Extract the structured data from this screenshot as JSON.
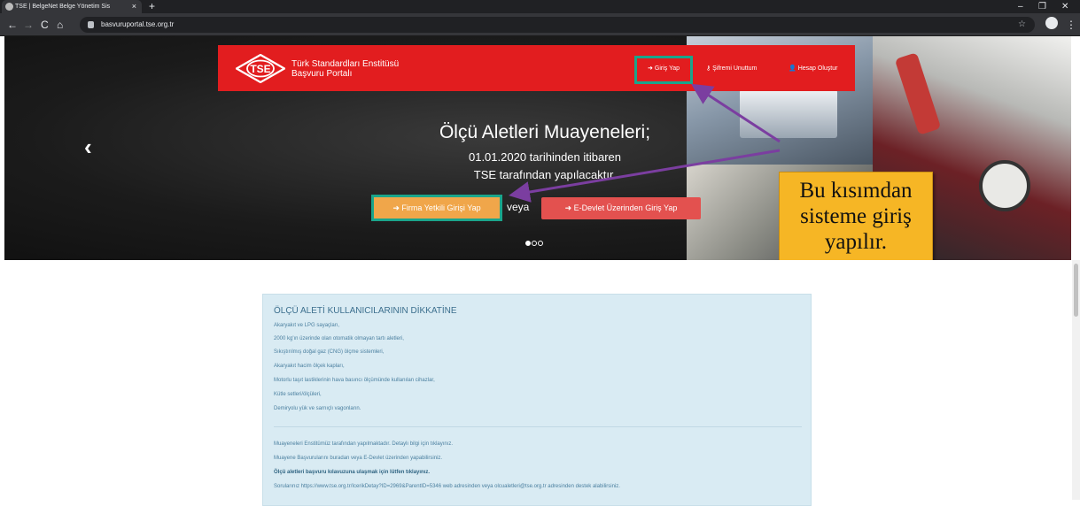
{
  "browser": {
    "tab_title": "TSE | BelgeNet Belge Yönetim Sis",
    "tab_close": "×",
    "new_tab": "+",
    "url": "basvuruportal.tse.org.tr",
    "nav_back": "←",
    "nav_forward": "→",
    "nav_reload": "C",
    "nav_home": "⌂",
    "star": "☆",
    "menu": "⋮",
    "win_min": "–",
    "win_max": "❐",
    "win_close": "✕"
  },
  "header": {
    "org_line1": "Türk Standardları Enstitüsü",
    "org_line2": "Başvuru Portalı",
    "logo_text": "TSE",
    "nav_login": "Giriş Yap",
    "nav_forgot": "Şifremi Unuttum",
    "nav_register": "Hesap Oluştur",
    "brand_color": "#e21d1f"
  },
  "hero": {
    "prev_arrow": "‹",
    "heading": "Ölçü Aletleri Muayeneleri;",
    "line1": "01.01.2020 tarihinden itibaren",
    "line2": "TSE tarafından yapılacaktır.",
    "btn_firma": "Firma Yetkili Girişi Yap",
    "veya": "veya",
    "btn_edevlet": "E-Devlet Üzerinden Giriş Yap"
  },
  "callout": {
    "line1": "Bu kısımdan",
    "line2": "sisteme giriş",
    "line3": "yapılır.",
    "color": "#f6b625",
    "highlight_color": "#1aa58b",
    "arrow_color": "#7b3ea0"
  },
  "notice": {
    "title": "ÖLÇÜ ALETİ KULLANICILARININ DİKKATİNE",
    "items": [
      "Akaryakıt ve LPG sayaçları,",
      "2000 kg'ın üzerinde olan otomatik olmayan tartı aletleri,",
      "Sıkıştırılmış doğal gaz (CNG) ölçme sistemleri,",
      "Akaryakıt hacim ölçek kapları,",
      "Motorlu taşıt lastiklerinin hava basıncı ölçümünde kullanılan cihazlar,",
      "Kütle setleri/ölçüleri,",
      "Demiryolu yük ve sarnıçlı vagonların."
    ],
    "para1": "Muayeneleri Enstitümüz tarafından yapılmaktadır. Detaylı bilgi için tıklayınız.",
    "para2": "Muayene Başvurularını buradan veya E-Devlet üzerinden yapabilirsiniz.",
    "para3": "Ölçü aletleri başvuru kılavuzuna ulaşmak için lütfen tıklayınız.",
    "para4": "Sorularınız https://www.tse.org.tr/IcerikDetay?ID=2969&ParentID=5346 web adresinden veya olcualetleri@tse.org.tr adresinden destek alabilirsiniz."
  }
}
